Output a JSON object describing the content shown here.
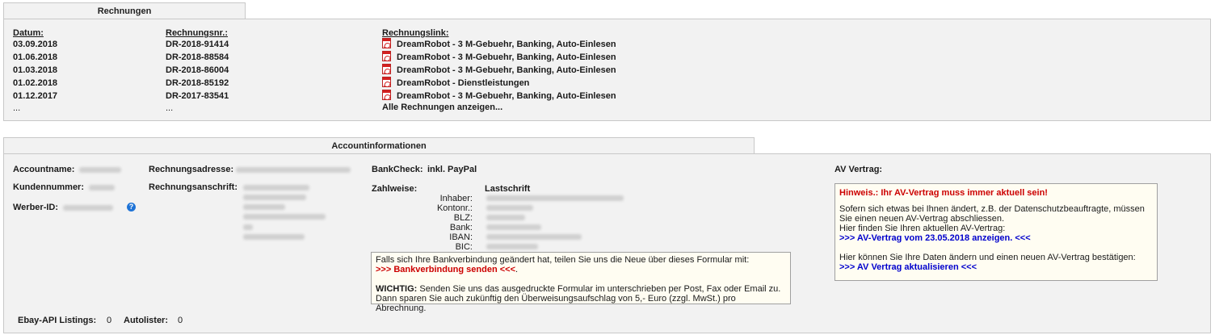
{
  "invoices": {
    "tab_title": "Rechnungen",
    "headers": {
      "date": "Datum:",
      "number": "Rechnungsnr.:",
      "link": "Rechnungslink:"
    },
    "rows": [
      {
        "date": "03.09.2018",
        "number": "DR-2018-91414",
        "link": "DreamRobot - 3 M-Gebuehr, Banking, Auto-Einlesen"
      },
      {
        "date": "01.06.2018",
        "number": "DR-2018-88584",
        "link": "DreamRobot - 3 M-Gebuehr, Banking, Auto-Einlesen"
      },
      {
        "date": "01.03.2018",
        "number": "DR-2018-86004",
        "link": "DreamRobot - 3 M-Gebuehr, Banking, Auto-Einlesen"
      },
      {
        "date": "01.02.2018",
        "number": "DR-2018-85192",
        "link": "DreamRobot - Dienstleistungen"
      },
      {
        "date": "01.12.2017",
        "number": "DR-2017-83541",
        "link": "DreamRobot - 3 M-Gebuehr, Banking, Auto-Einlesen"
      }
    ],
    "ellipsis": "...",
    "show_all": "Alle Rechnungen anzeigen..."
  },
  "account": {
    "tab_title": "Accountinformationen",
    "accountname_label": "Accountname:",
    "kundennummer_label": "Kundennummer:",
    "werber_label": "Werber-ID:",
    "rechnungsadresse_label": "Rechnungsadresse:",
    "rechnungsanschrift_label": "Rechnungsanschrift:",
    "bankcheck_label": "BankCheck:",
    "bankcheck_value": "inkl. PayPal",
    "zahlweise_label": "Zahlweise:",
    "zahlweise_value": "Lastschrift",
    "bank_fields": [
      "Inhaber:",
      "Kontonr.:",
      "BLZ:",
      "Bank:",
      "IBAN:",
      "BIC:"
    ],
    "bank_note": {
      "line1": "Falls sich Ihre Bankverbindung geändert hat, teilen Sie uns die Neue über dieses Formular mit:",
      "link": ">>> Bankverbindung senden <<<",
      "link_suffix": ".",
      "important_label": "WICHTIG:",
      "important_text": " Senden Sie uns das ausgedruckte Formular im unterschrieben per Post, Fax oder Email zu.",
      "line4": "Dann sparen Sie auch zukünftig den Überweisungsaufschlag von 5,- Euro (zzgl. MwSt.) pro Abrechnung."
    },
    "av_label": "AV Vertrag:",
    "av_box": {
      "hint": "Hinweis.:  Ihr AV-Vertrag muss immer aktuell sein!",
      "p1": "Sofern sich etwas bei Ihnen ändert, z.B. der Datenschutzbeauftragte, müssen",
      "p2": "Sie einen neuen AV-Vertrag abschliessen.",
      "p3": "Hier finden Sie Ihren aktuellen AV-Vertrag:",
      "link1": ">>> AV-Vertrag vom 23.05.2018 anzeigen. <<<",
      "p4": "Hier können Sie Ihre Daten ändern und einen neuen AV-Vertrag bestätigen:",
      "link2": ">>> AV Vertrag aktualisieren <<<"
    },
    "ebay_label": "Ebay-API Listings:",
    "ebay_value": "0",
    "autolister_label": "Autolister:",
    "autolister_value": "0",
    "help_icon": "question-circle-icon"
  }
}
